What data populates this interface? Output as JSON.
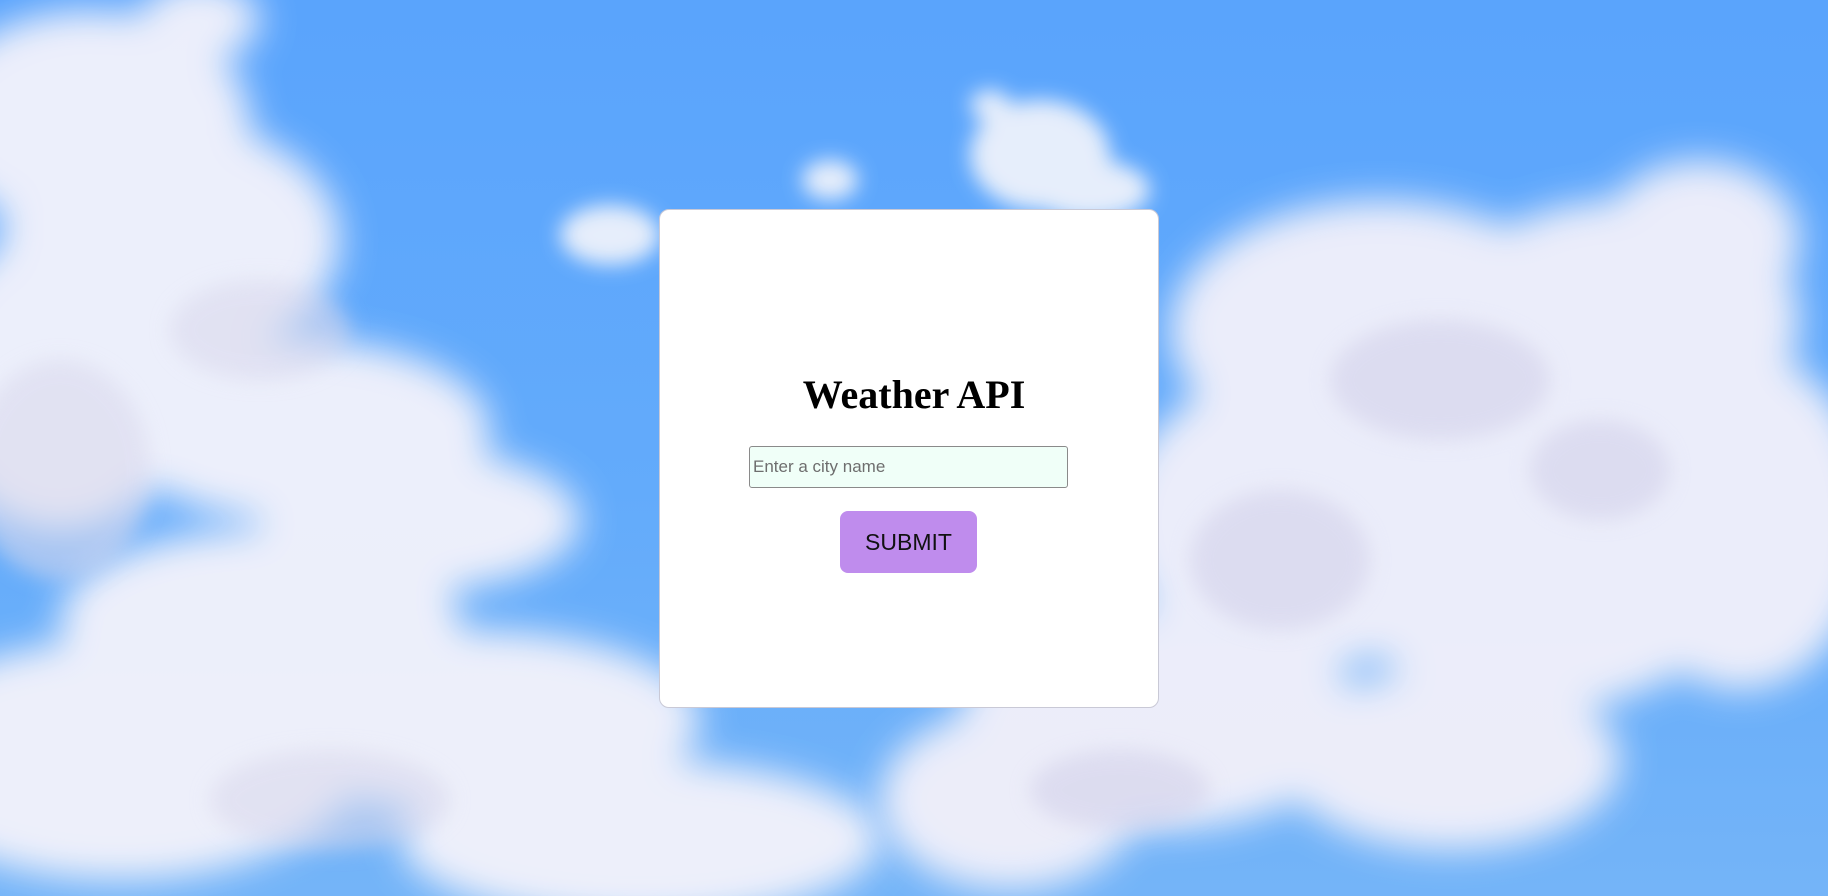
{
  "app": {
    "title": "Weather API"
  },
  "form": {
    "city_placeholder": "Enter a city name",
    "city_value": "",
    "submit_label": "SUBMIT"
  },
  "colors": {
    "sky": "#5fa6fb",
    "card": "#ffffff",
    "input_bg": "#f0fff8",
    "button": "#bf8ced"
  },
  "icons": {
    "background": "sky-clouds-background"
  }
}
